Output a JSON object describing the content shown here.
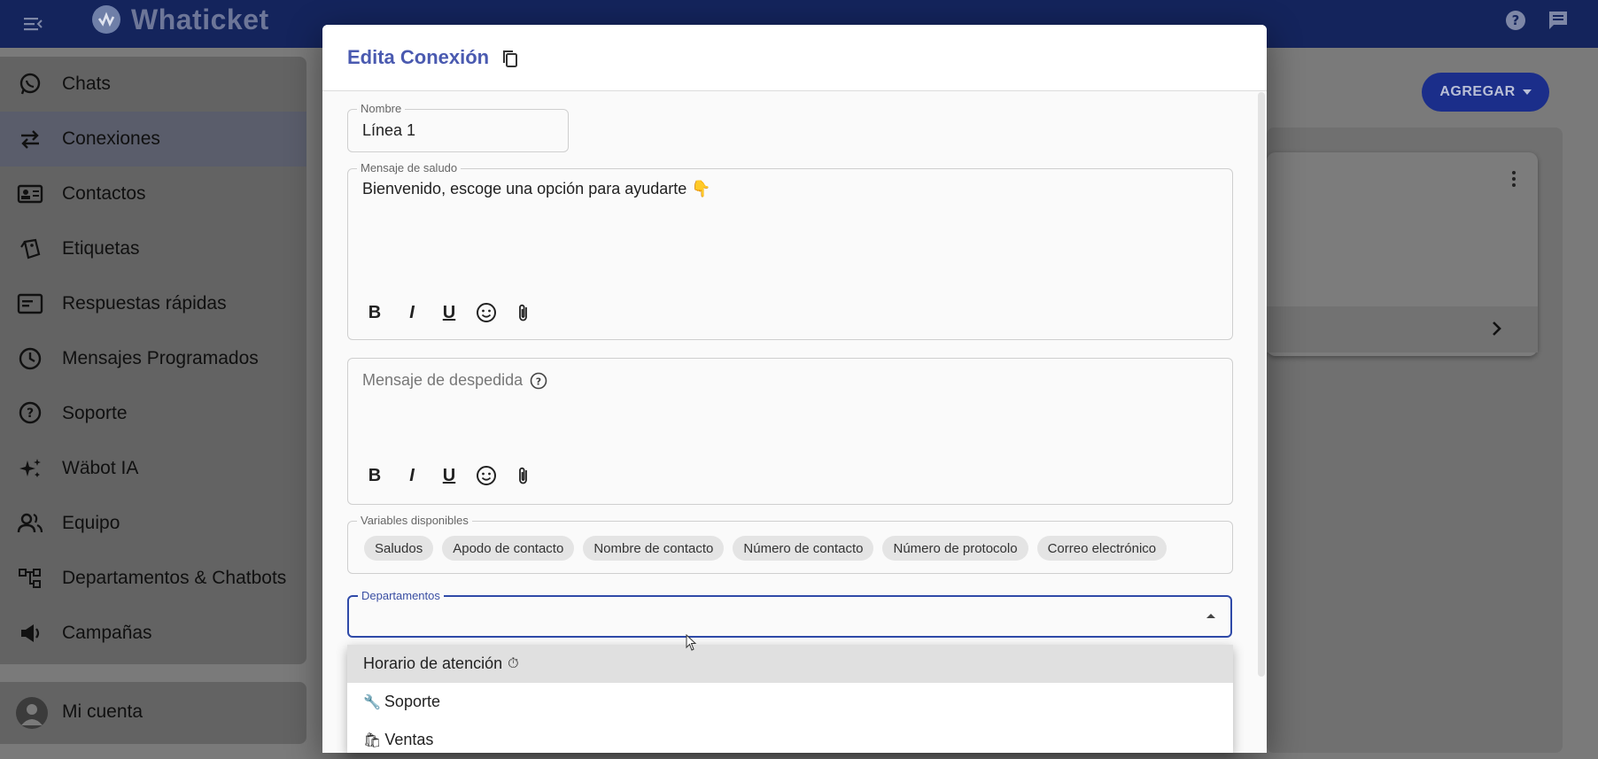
{
  "app": {
    "name": "Whaticket"
  },
  "sidebar": {
    "items": [
      {
        "label": "Chats",
        "icon": "whatsapp-icon"
      },
      {
        "label": "Conexiones",
        "icon": "swap-arrows-icon",
        "active": true
      },
      {
        "label": "Contactos",
        "icon": "contact-card-icon"
      },
      {
        "label": "Etiquetas",
        "icon": "tag-icon"
      },
      {
        "label": "Respuestas rápidas",
        "icon": "quick-reply-icon"
      },
      {
        "label": "Mensajes Programados",
        "icon": "clock-icon"
      },
      {
        "label": "Soporte",
        "icon": "help-circle-icon"
      },
      {
        "label": "Wäbot IA",
        "icon": "sparkle-icon"
      },
      {
        "label": "Equipo",
        "icon": "people-icon"
      },
      {
        "label": "Departamentos & Chatbots",
        "icon": "org-chart-icon"
      },
      {
        "label": "Campañas",
        "icon": "megaphone-icon"
      }
    ],
    "account": {
      "label": "Mi cuenta",
      "icon": "avatar-icon"
    }
  },
  "background": {
    "add_button": "AGREGAR"
  },
  "dialog": {
    "title": "Edita Conexión",
    "name_field": {
      "label": "Nombre",
      "value": "Línea 1"
    },
    "greeting": {
      "label": "Mensaje de saludo",
      "value": "Bienvenido, escoge una opción para ayudarte 👇"
    },
    "farewell": {
      "placeholder": "Mensaje de despedida"
    },
    "toolbar": {
      "bold": "B",
      "italic": "I",
      "underline": "U"
    },
    "variables": {
      "label": "Variables disponibles",
      "chips": [
        "Saludos",
        "Apodo de contacto",
        "Nombre de contacto",
        "Número de contacto",
        "Número de protocolo",
        "Correo electrónico"
      ]
    },
    "departments": {
      "label": "Departamentos",
      "options": [
        {
          "label": "Horario de atención",
          "emoji": "⏱"
        },
        {
          "label": "Soporte",
          "emoji": "🔧"
        },
        {
          "label": "Ventas",
          "emoji": "🛍"
        }
      ]
    }
  },
  "colors": {
    "primary": "#2f4aa8",
    "topbar": "#14245c",
    "title": "#4a5ab0"
  }
}
